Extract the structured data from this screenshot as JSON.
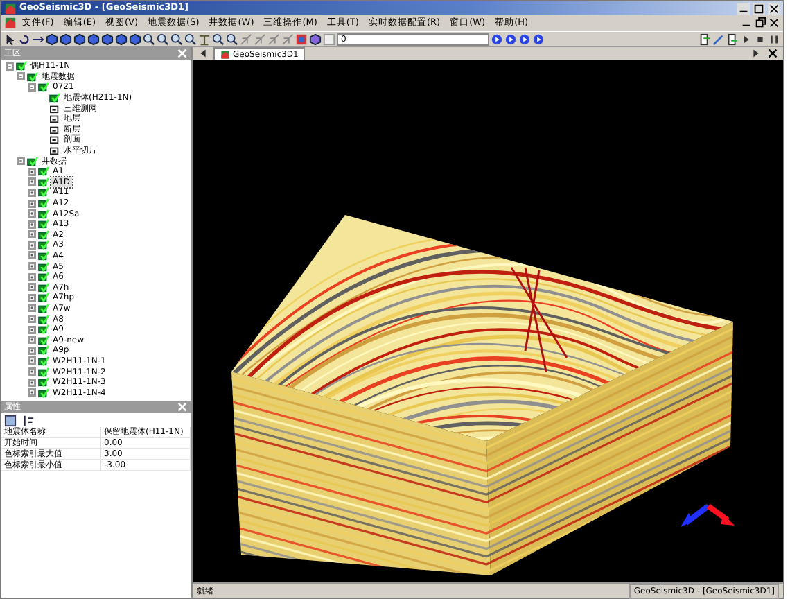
{
  "window": {
    "title": "GeoSeismic3D - [GeoSeismic3D1]"
  },
  "menu": [
    {
      "label": "文件(F)"
    },
    {
      "label": "编辑(E)"
    },
    {
      "label": "视图(V)"
    },
    {
      "label": "地震数据(S)"
    },
    {
      "label": "井数据(W)"
    },
    {
      "label": "三维操作(M)"
    },
    {
      "label": "工具(T)"
    },
    {
      "label": "实时数据配置(R)"
    },
    {
      "label": "窗口(W)"
    },
    {
      "label": "帮助(H)"
    }
  ],
  "toolbar": {
    "value": "0"
  },
  "workspace": {
    "title": "工区",
    "tree": [
      {
        "label": "偶H11-1N",
        "checked": true,
        "expanded": true,
        "selected": false,
        "children": [
          {
            "label": "地震数据",
            "checked": true,
            "expanded": true,
            "selected": false,
            "children": [
              {
                "label": "0721",
                "checked": true,
                "expanded": true,
                "selected": false,
                "children": [
                  {
                    "label": "地震体(H211-1N)",
                    "checked": true,
                    "selected": false
                  },
                  {
                    "label": "三维测网",
                    "checked": false,
                    "selected": false
                  },
                  {
                    "label": "地层",
                    "checked": false,
                    "selected": false
                  },
                  {
                    "label": "断层",
                    "checked": false,
                    "selected": false
                  },
                  {
                    "label": "剖面",
                    "checked": false,
                    "selected": false
                  },
                  {
                    "label": "水平切片",
                    "checked": false,
                    "selected": false
                  }
                ]
              }
            ]
          },
          {
            "label": "井数据",
            "checked": true,
            "expanded": true,
            "selected": false,
            "children": [
              {
                "label": "A1",
                "checked": true,
                "expanded": false,
                "selected": false
              },
              {
                "label": "A1D",
                "checked": true,
                "expanded": false,
                "selected": true
              },
              {
                "label": "A11",
                "checked": true,
                "expanded": false,
                "selected": false
              },
              {
                "label": "A12",
                "checked": true,
                "expanded": false,
                "selected": false
              },
              {
                "label": "A12Sa",
                "checked": true,
                "expanded": false,
                "selected": false
              },
              {
                "label": "A13",
                "checked": true,
                "expanded": false,
                "selected": false
              },
              {
                "label": "A2",
                "checked": true,
                "expanded": false,
                "selected": false
              },
              {
                "label": "A3",
                "checked": true,
                "expanded": false,
                "selected": false
              },
              {
                "label": "A4",
                "checked": true,
                "expanded": false,
                "selected": false
              },
              {
                "label": "A5",
                "checked": true,
                "expanded": false,
                "selected": false
              },
              {
                "label": "A6",
                "checked": true,
                "expanded": false,
                "selected": false
              },
              {
                "label": "A7h",
                "checked": true,
                "expanded": false,
                "selected": false
              },
              {
                "label": "A7hp",
                "checked": true,
                "expanded": false,
                "selected": false
              },
              {
                "label": "A7w",
                "checked": true,
                "expanded": false,
                "selected": false
              },
              {
                "label": "A8",
                "checked": true,
                "expanded": false,
                "selected": false
              },
              {
                "label": "A9",
                "checked": true,
                "expanded": false,
                "selected": false
              },
              {
                "label": "A9-new",
                "checked": true,
                "expanded": false,
                "selected": false
              },
              {
                "label": "A9p",
                "checked": true,
                "expanded": false,
                "selected": false
              },
              {
                "label": "W2H11-1N-1",
                "checked": true,
                "expanded": false,
                "selected": false
              },
              {
                "label": "W2H11-1N-2",
                "checked": true,
                "expanded": false,
                "selected": false
              },
              {
                "label": "W2H11-1N-3",
                "checked": true,
                "expanded": false,
                "selected": false
              },
              {
                "label": "W2H11-1N-4",
                "checked": true,
                "expanded": false,
                "selected": false
              }
            ]
          }
        ]
      }
    ]
  },
  "properties": {
    "title": "属性",
    "rows": [
      {
        "name": "地震体名称",
        "value": "保留地震体(H11-1N)"
      },
      {
        "name": "开始时间",
        "value": "0.00"
      },
      {
        "name": "色标索引最大值",
        "value": "3.00"
      },
      {
        "name": "色标索引最小值",
        "value": "-3.00"
      }
    ]
  },
  "document_tab": {
    "label": "GeoSeismic3D1",
    "selected": true
  },
  "status_bar": {
    "message": "就绪",
    "panes": [
      "GeoSeismic3D - [GeoSeismic3D1]"
    ]
  }
}
